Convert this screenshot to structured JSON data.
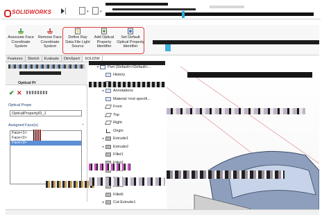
{
  "app": {
    "brand": "SOLIDWORKS"
  },
  "ribbon": {
    "buttons": [
      {
        "label": "Associate Face Coordinate System",
        "icon": "associate-face-icon"
      },
      {
        "label": "Remove Face Coordinate System",
        "icon": "remove-face-icon"
      },
      {
        "label": "Define Ray Data File Light Source",
        "icon": "ray-data-light-icon"
      },
      {
        "label": "Add Optical Property Identifier",
        "icon": "add-optical-property-icon"
      },
      {
        "label": "Set Default Optical Property Identifier",
        "icon": "set-default-optical-icon"
      }
    ]
  },
  "tabs": [
    "Features",
    "Sketch",
    "Evaluate",
    "DimXpert",
    "SOLIDW"
  ],
  "property_manager": {
    "title": "Optical Pr",
    "optical_property_label": "Optical Prope",
    "name_value": "OpticalPropertyID_1",
    "assigned_faces_label": "Assigned Face(s)",
    "faces": [
      "Face<1>",
      "Face<2>",
      "Face<3>"
    ],
    "selected_face_index": 2
  },
  "feature_tree": {
    "items": [
      {
        "label": "Part (Default<<Default>...",
        "expander": "▾",
        "icon": "part-icon"
      },
      {
        "label": "History",
        "expander": "",
        "icon": "history-icon"
      },
      {
        "label": "Sensors",
        "expander": "",
        "icon": "sensor-icon"
      },
      {
        "label": "Annotations",
        "expander": "▸",
        "icon": "annotation-icon"
      },
      {
        "label": "Material <not specifi...",
        "expander": "",
        "icon": "material-icon"
      },
      {
        "label": "Front",
        "expander": "",
        "icon": "plane-icon"
      },
      {
        "label": "Top",
        "expander": "",
        "icon": "plane-icon"
      },
      {
        "label": "Right",
        "expander": "",
        "icon": "plane-icon"
      },
      {
        "label": "Origin",
        "expander": "",
        "icon": "origin-icon"
      },
      {
        "label": "Extrude1",
        "expander": "▸",
        "icon": "extrude-icon"
      },
      {
        "label": "Extrude2",
        "expander": "▸",
        "icon": "extrude-icon"
      },
      {
        "label": "Fillet1",
        "expander": "",
        "icon": "fillet-icon"
      },
      {
        "label": "Fillet2",
        "expander": "",
        "icon": "fillet-icon"
      },
      {
        "label": "Fillet3",
        "expander": "",
        "icon": "fillet-icon"
      },
      {
        "label": "Fillet4",
        "expander": "",
        "icon": "fillet-icon"
      },
      {
        "label": "Fillet5",
        "expander": "",
        "icon": "fillet-icon"
      },
      {
        "label": "Fillet6",
        "expander": "",
        "icon": "fillet-icon"
      },
      {
        "label": "Cut-Extrude1",
        "expander": "▸",
        "icon": "cut-extrude-icon"
      }
    ]
  },
  "colors": {
    "brand_red": "#d9262b",
    "highlight_box": "#e04040",
    "selection_blue": "#5b8fd6",
    "model_body": "#8d9fbd"
  }
}
